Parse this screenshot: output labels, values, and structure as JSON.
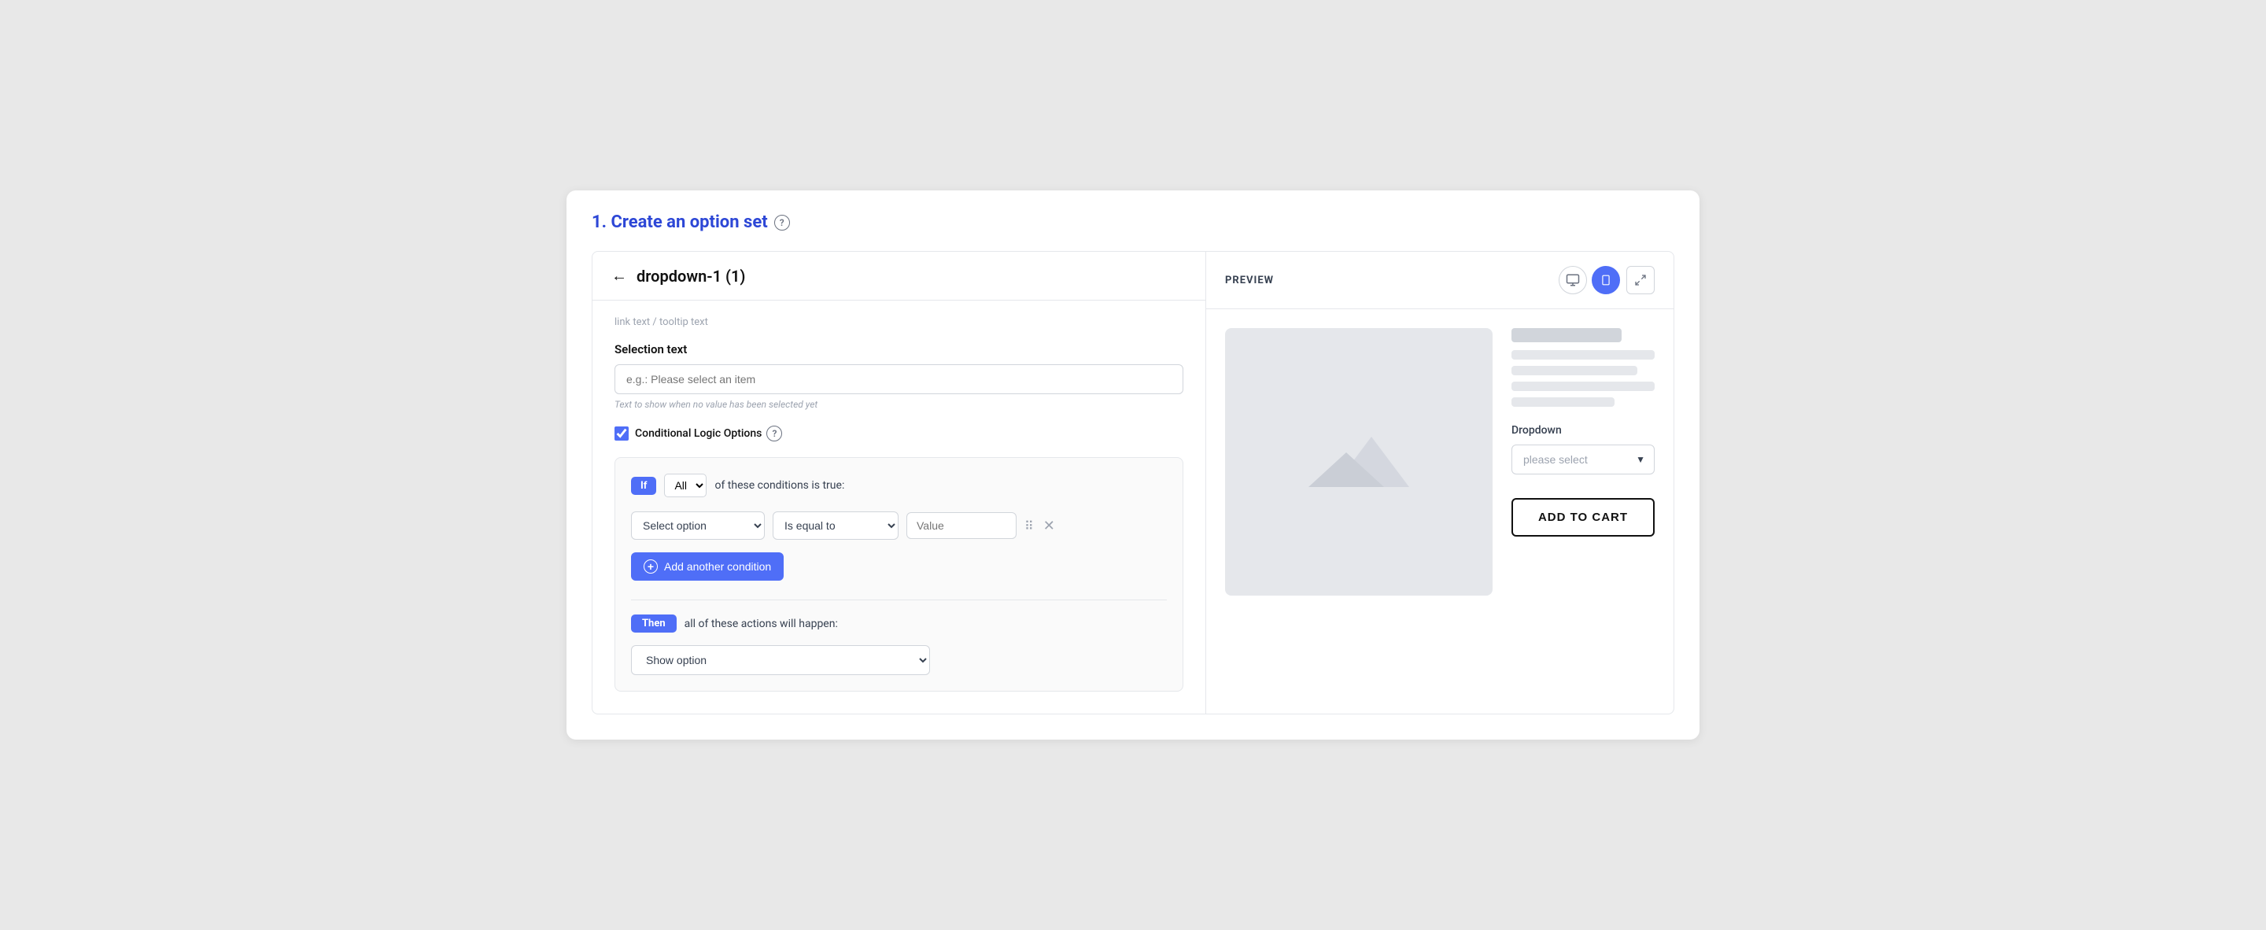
{
  "page": {
    "title": "1. Create an option set",
    "help_icon": "?"
  },
  "left_panel": {
    "back_label": "←",
    "panel_title": "dropdown-1 (1)",
    "faded_text": "link text / tooltip text",
    "selection_text_label": "Selection text",
    "selection_text_placeholder": "e.g.: Please select an item",
    "selection_hint": "Text to show when no value has been selected yet",
    "conditional_logic_label": "Conditional Logic Options",
    "conditional_logic_checked": true,
    "if_label": "If",
    "all_option": "All",
    "condition_text": "of these conditions is true:",
    "select_option_label": "Select option",
    "is_equal_to_label": "Is equal to",
    "value_placeholder": "Value",
    "add_condition_label": "Add another condition",
    "then_label": "Then",
    "actions_text": "all of these actions will happen:",
    "show_option_label": "Show option"
  },
  "right_panel": {
    "preview_label": "PREVIEW",
    "view_toggle_desktop_label": "desktop-view",
    "view_toggle_mobile_label": "mobile-view",
    "expand_label": "expand",
    "dropdown_label": "Dropdown",
    "dropdown_placeholder": "please select",
    "add_to_cart_label": "ADD TO CART"
  }
}
